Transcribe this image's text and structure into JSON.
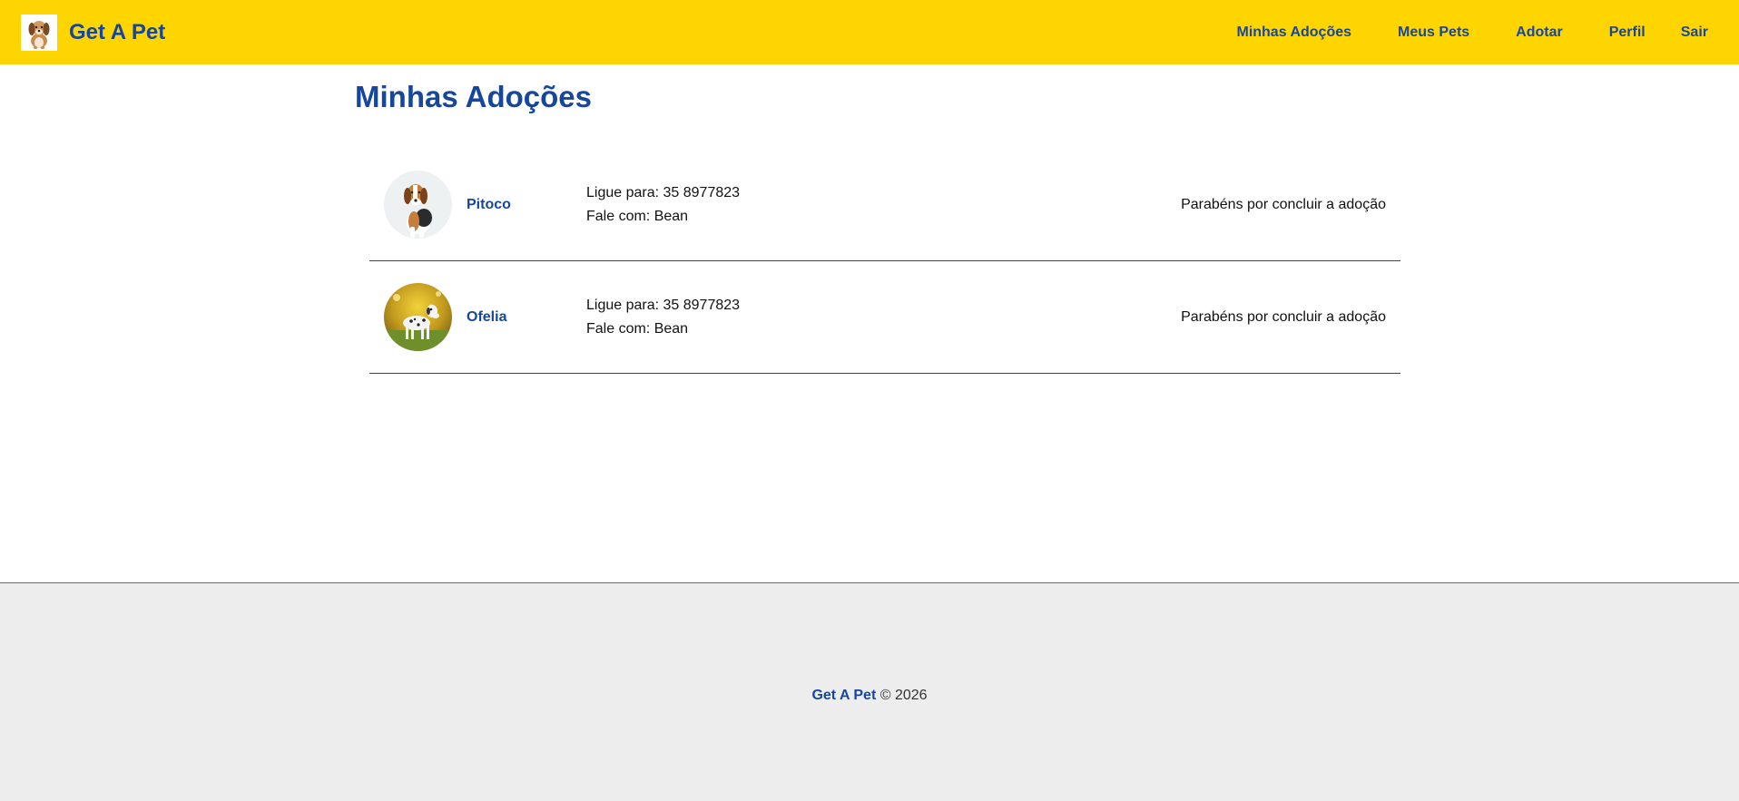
{
  "header": {
    "brand": "Get A Pet",
    "logo_icon": "dog-logo-icon",
    "nav": [
      {
        "label": "Minhas Adoções"
      },
      {
        "label": "Meus Pets"
      },
      {
        "label": "Adotar"
      },
      {
        "label": "Perfil"
      },
      {
        "label": "Sair"
      }
    ]
  },
  "main": {
    "title": "Minhas Adoções",
    "adoptions": [
      {
        "name": "Pitoco",
        "photo_icon": "beagle-photo",
        "phone": "Ligue para: 35 8977823",
        "contact": "Fale com: Bean",
        "status": "Parabéns por concluir a adoção"
      },
      {
        "name": "Ofelia",
        "photo_icon": "dalmatian-photo",
        "phone": "Ligue para: 35 8977823",
        "contact": "Fale com: Bean",
        "status": "Parabéns por concluir a adoção"
      }
    ]
  },
  "footer": {
    "brand": "Get A Pet",
    "copyright": "© 2026"
  },
  "colors": {
    "navbar": "#ffd500",
    "primary": "#16479c",
    "footer_bg": "#ededed"
  }
}
